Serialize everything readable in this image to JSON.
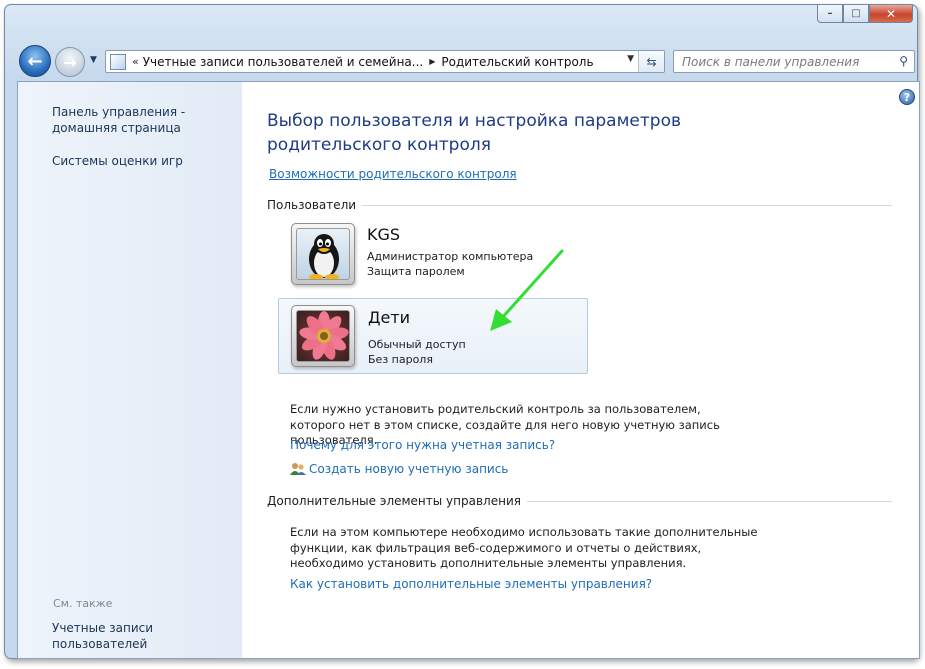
{
  "window": {
    "controls": {
      "minimize": "–",
      "maximize": "□",
      "close": "✕"
    }
  },
  "nav": {
    "back_glyph": "←",
    "forward_glyph": "→",
    "address_chevron": "«",
    "breadcrumb": [
      "Учетные записи пользователей и семейна...",
      "Родительский контроль"
    ],
    "search_placeholder": "Поиск в панели управления"
  },
  "sidebar": {
    "items": [
      {
        "label": "Панель управления - домашняя страница"
      },
      {
        "label": "Системы оценки игр"
      }
    ],
    "see_also_heading": "См. также",
    "see_also_items": [
      {
        "label": "Учетные записи пользователей"
      }
    ]
  },
  "main": {
    "title": "Выбор пользователя и настройка параметров родительского контроля",
    "features_link": "Возможности родительского контроля",
    "users_section": "Пользователи",
    "users": [
      {
        "name": "KGS",
        "role": "Администратор компьютера",
        "password": "Защита паролем",
        "avatar": "penguin-avatar"
      },
      {
        "name": "Дети",
        "role": "Обычный доступ",
        "password": "Без пароля",
        "avatar": "flower-avatar"
      }
    ],
    "hint": "Если нужно установить родительский контроль за пользователем, которого нет в этом списке, создайте для него новую учетную запись пользователя.",
    "why_link": "Почему для этого нужна учетная запись?",
    "create_link": "Создать новую учетную запись",
    "extra_section": "Дополнительные элементы управления",
    "extra_text": "Если на этом компьютере необходимо использовать такие дополнительные функции, как фильтрация веб-содержимого и отчеты о действиях, необходимо установить дополнительные элементы управления.",
    "extra_link": "Как установить дополнительные элементы управления?"
  },
  "colors": {
    "link": "#1f6db8",
    "title": "#1e3b87",
    "annotation_arrow": "#33dd33"
  }
}
